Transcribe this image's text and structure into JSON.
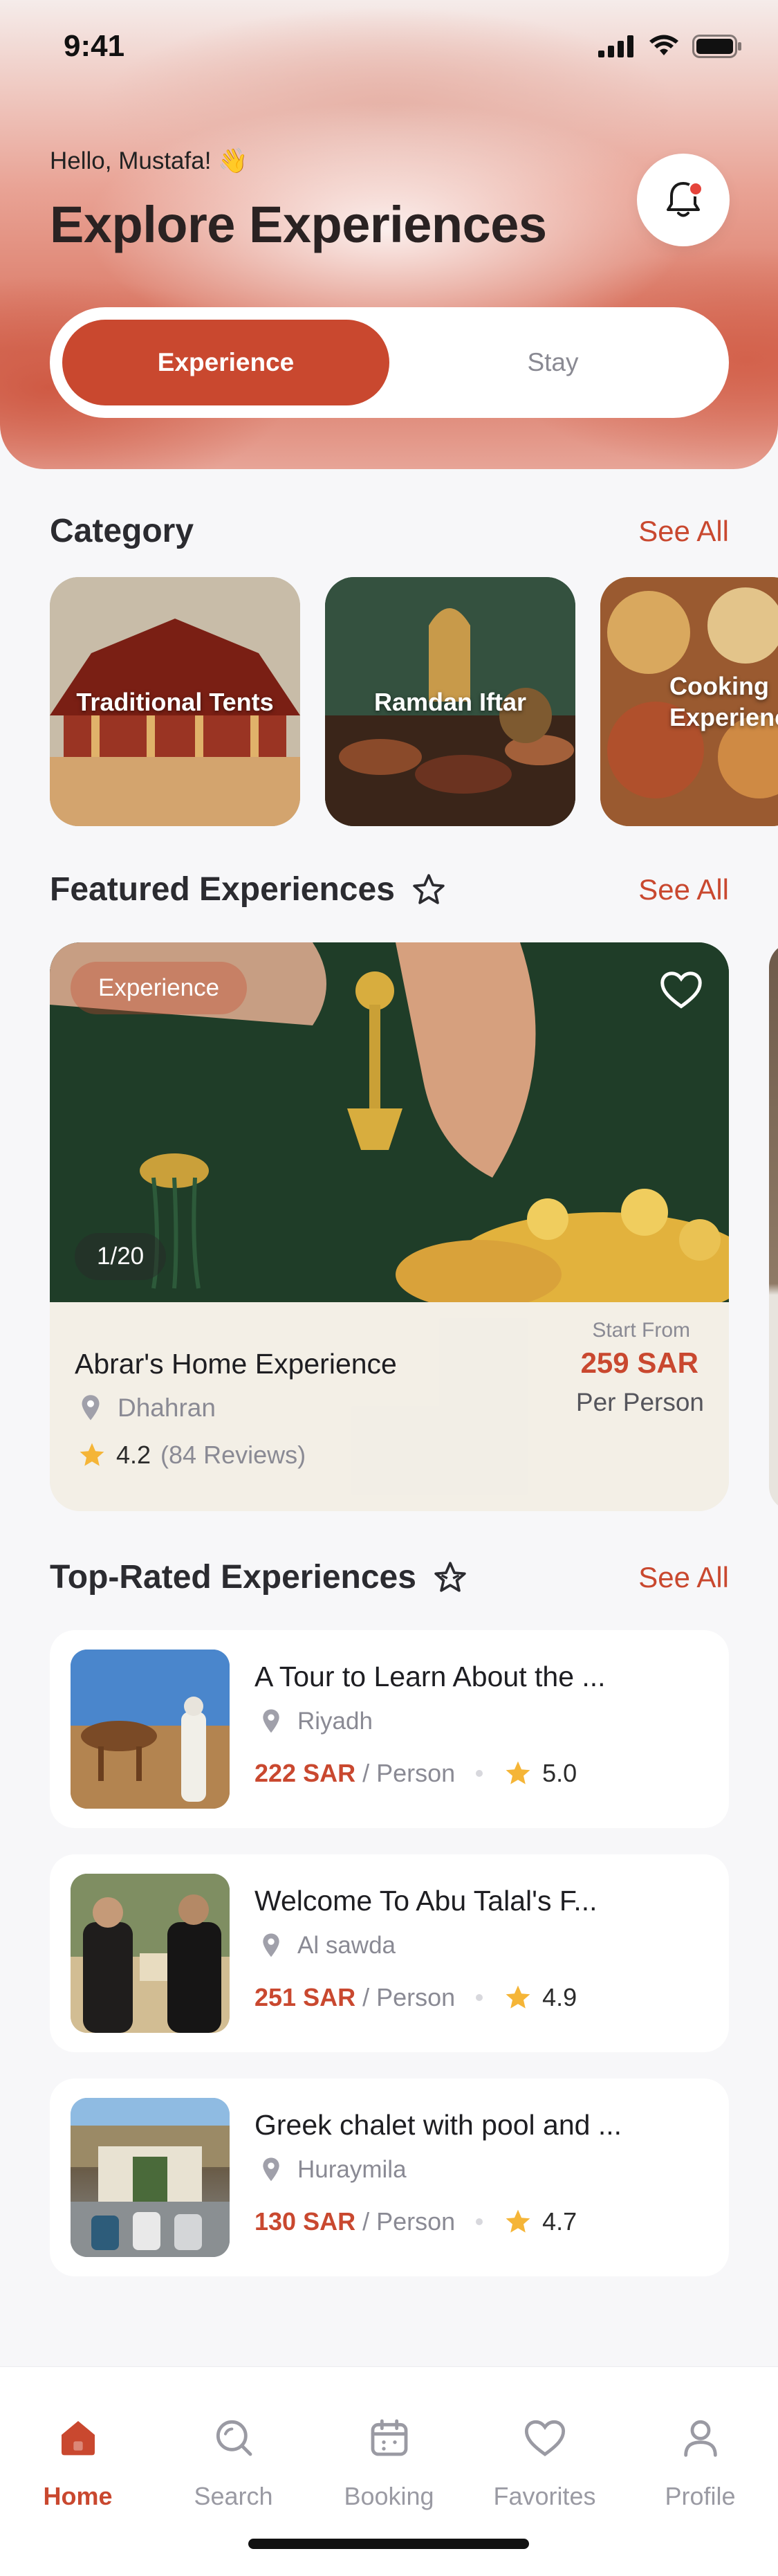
{
  "status_bar": {
    "time": "9:41"
  },
  "header": {
    "greeting": "Hello, Mustafa! 👋",
    "title": "Explore Experiences"
  },
  "toggle": {
    "options": [
      {
        "label": "Experience",
        "active": true
      },
      {
        "label": "Stay",
        "active": false
      }
    ]
  },
  "category": {
    "title": "Category",
    "see_all": "See All",
    "items": [
      {
        "label": "Traditional Tents"
      },
      {
        "label": "Ramdan Iftar"
      },
      {
        "label": "Cooking Experience"
      }
    ]
  },
  "featured": {
    "title": "Featured Experiences",
    "see_all": "See All",
    "card": {
      "badge": "Experience",
      "counter": "1/20",
      "name": "Abrar's Home Experience",
      "location": "Dhahran",
      "rating": "4.2",
      "reviews": "(84 Reviews)",
      "start_from": "Start From",
      "price": "259 SAR",
      "per": "Per Person"
    }
  },
  "top_rated": {
    "title": "Top-Rated Experiences",
    "see_all": "See All",
    "items": [
      {
        "title": "A Tour to Learn About the ...",
        "location": "Riyadh",
        "price": "222 SAR",
        "per": "/ Person",
        "rating": "5.0"
      },
      {
        "title": "Welcome To Abu Talal's F...",
        "location": "Al sawda",
        "price": "251 SAR",
        "per": "/ Person",
        "rating": "4.9"
      },
      {
        "title": "Greek chalet with pool and ...",
        "location": "Huraymila",
        "price": "130 SAR",
        "per": "/ Person",
        "rating": "4.7"
      }
    ]
  },
  "tab_bar": {
    "tabs": [
      {
        "label": "Home",
        "icon": "home-icon",
        "active": true
      },
      {
        "label": "Search",
        "icon": "search-icon",
        "active": false
      },
      {
        "label": "Booking",
        "icon": "calendar-icon",
        "active": false
      },
      {
        "label": "Favorites",
        "icon": "heart-icon",
        "active": false
      },
      {
        "label": "Profile",
        "icon": "user-icon",
        "active": false
      }
    ]
  },
  "colors": {
    "accent": "#c9482f",
    "muted": "#8a8a94",
    "star": "#f5b537"
  }
}
